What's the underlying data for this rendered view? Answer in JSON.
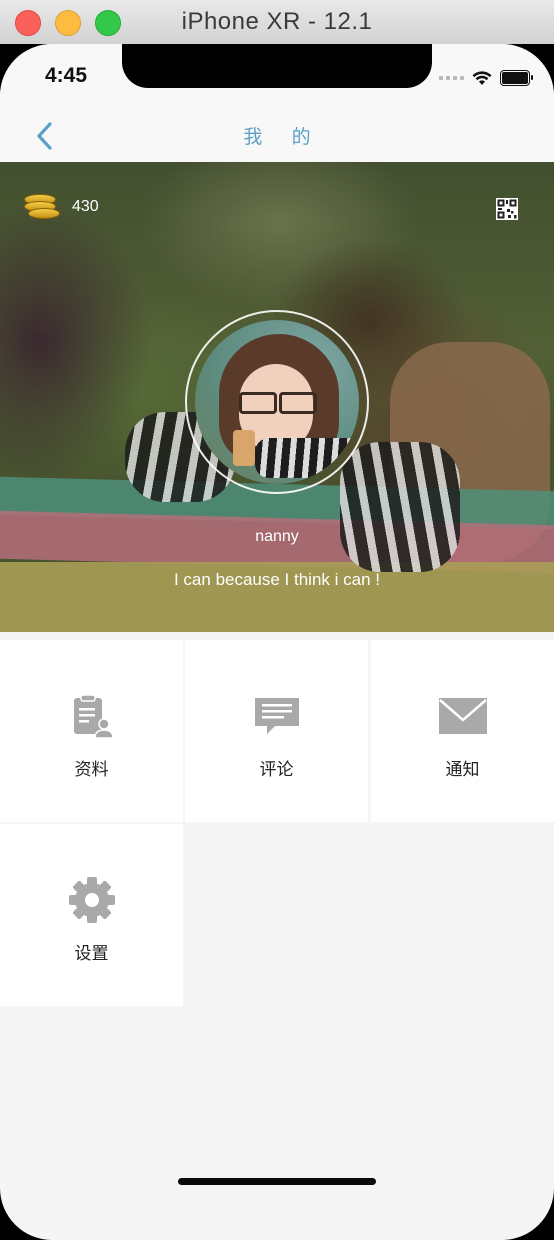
{
  "window": {
    "title": "iPhone XR - 12.1"
  },
  "status_bar": {
    "time": "4:45"
  },
  "nav": {
    "title": "我 的",
    "back_icon": "chevron-left-icon"
  },
  "profile": {
    "coins": "430",
    "username": "nanny",
    "motto": "I can because I think i can !",
    "qr_icon": "qr-code-icon"
  },
  "menu": [
    {
      "label": "资料",
      "icon": "profile-document-icon"
    },
    {
      "label": "评论",
      "icon": "comment-bubble-icon"
    },
    {
      "label": "通知",
      "icon": "envelope-icon"
    },
    {
      "label": "设置",
      "icon": "gear-icon"
    }
  ],
  "colors": {
    "accent": "#5aa0c8",
    "icon_gray": "#a9a9a9",
    "background": "#f5f5f5"
  }
}
